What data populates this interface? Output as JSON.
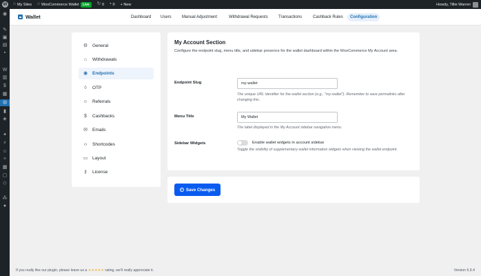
{
  "admin_bar": {
    "my_sites": "My Sites",
    "site_name": "WooCommerce Wallet",
    "live_badge": "Live",
    "comments_count": "0",
    "updates_count": "0",
    "new_label": "+ New",
    "greeting": "Howdy, Tillie Warren"
  },
  "header": {
    "app_title": "Wallet",
    "nav": [
      {
        "label": "Dashboard"
      },
      {
        "label": "Users"
      },
      {
        "label": "Manual Adjustment"
      },
      {
        "label": "Withdrawal Requests"
      },
      {
        "label": "Transactions"
      },
      {
        "label": "Cashback Rules"
      },
      {
        "label": "Configuration",
        "active": true
      }
    ]
  },
  "settings_nav": [
    {
      "label": "General",
      "icon": "gear-icon"
    },
    {
      "label": "Withdrawals",
      "icon": "bank-icon"
    },
    {
      "label": "Endpoints",
      "icon": "location-pin-icon",
      "active": true
    },
    {
      "label": "OTP",
      "icon": "shield-icon"
    },
    {
      "label": "Referrals",
      "icon": "users-icon"
    },
    {
      "label": "Cashbacks",
      "icon": "dollar-icon"
    },
    {
      "label": "Emails",
      "icon": "envelope-icon"
    },
    {
      "label": "Shortcodes",
      "icon": "code-icon"
    },
    {
      "label": "Layout",
      "icon": "layout-icon"
    },
    {
      "label": "License",
      "icon": "key-icon"
    }
  ],
  "section": {
    "title": "My Account Section",
    "description": "Configure the endpoint slug, menu title, and sidebar presence for the wallet dashboard within the WooCommerce My Account area.",
    "endpoint_slug": {
      "label": "Endpoint Slug",
      "value": "my-wallet",
      "help": "The unique URL identifier for the wallet section (e.g., \"my-wallet\"). Remember to save permalinks after changing this."
    },
    "menu_title": {
      "label": "Menu Title",
      "value": "My Wallet",
      "help": "The label displayed in the My Account sidebar navigation menu."
    },
    "sidebar_widgets": {
      "label": "Sidebar Widgets",
      "toggle_label": "Enable wallet widgets in account sidebar",
      "enabled": false,
      "help": "Toggle the visibility of supplementary wallet information widgets when viewing the wallet endpoint."
    }
  },
  "save_button": {
    "label": "Save Changes"
  },
  "footer": {
    "left_prefix": "If you really like our plugin, please leave us a",
    "stars": "★★★★★",
    "left_suffix": "rating, we'll really appreciate it.",
    "version": "Version 6.9.4"
  },
  "colors": {
    "accent": "#2271b1",
    "save_button": "#0a5bf0",
    "admin_bar": "#1d2327",
    "live_badge": "#00a32a"
  }
}
